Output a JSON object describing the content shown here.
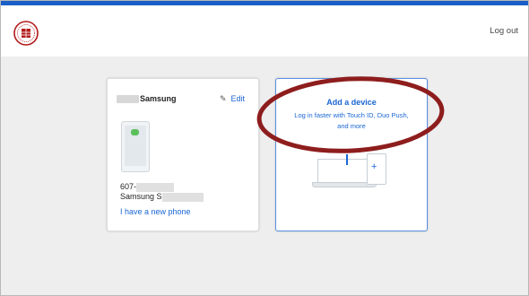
{
  "header": {
    "logo_icon": "university-seal-icon",
    "logout_label": "Log out"
  },
  "device_card": {
    "name_suffix": "Samsung",
    "edit_label": "Edit",
    "number_prefix": "607-",
    "model_prefix": "Samsung S",
    "new_phone_link": "I have a new phone",
    "icons": [
      "pencil-icon",
      "phone-illustration"
    ]
  },
  "add_card": {
    "title": "Add a device",
    "subtitle_line1": "Log in faster with Touch ID, Duo Push,",
    "subtitle_line2": "and more",
    "icon": "laptop-tablet-illustration"
  },
  "colors": {
    "accent": "#1a66d4",
    "annotation_oval": "#8e1d1d"
  }
}
